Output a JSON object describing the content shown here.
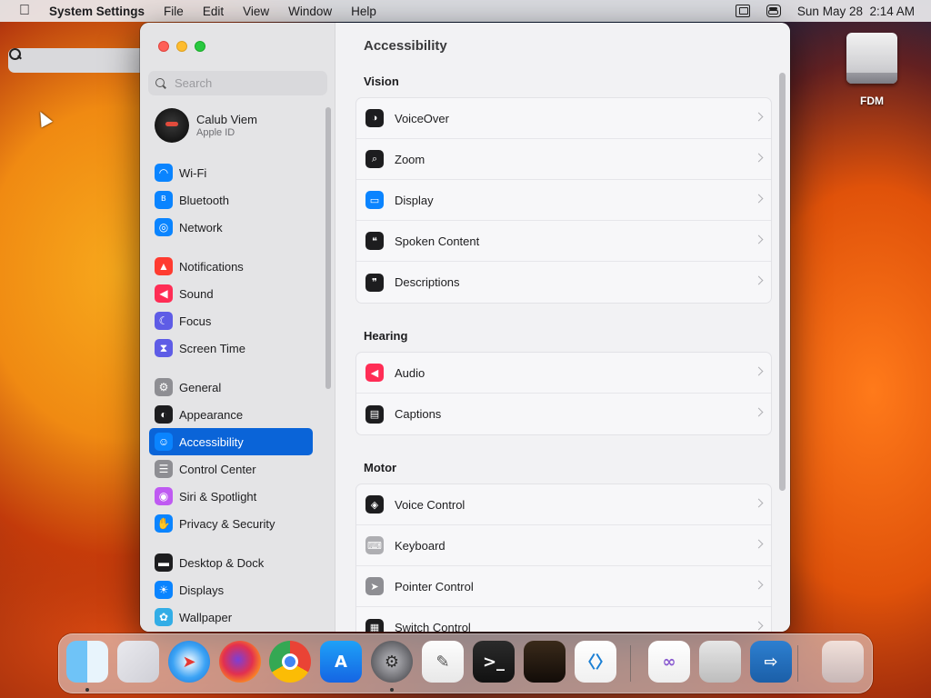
{
  "menubar": {
    "app_name": "System Settings",
    "menus": [
      "File",
      "Edit",
      "View",
      "Window",
      "Help"
    ],
    "clock": "Sun May 28  2:14 AM",
    "status_icons": [
      "window-switcher-icon",
      "spotlight-search-icon",
      "control-center-icon"
    ]
  },
  "desktop": {
    "drive_label": "FDM"
  },
  "sidebar": {
    "search_placeholder": "Search",
    "account_name": "Calub Viem",
    "account_subtitle": "Apple ID",
    "items": [
      {
        "label": "Wi-Fi",
        "icon": "wifi-icon",
        "color": "#0a84ff"
      },
      {
        "label": "Bluetooth",
        "icon": "bluetooth-icon",
        "color": "#0a84ff"
      },
      {
        "label": "Network",
        "icon": "globe-icon",
        "color": "#0a84ff"
      },
      {
        "label": "Notifications",
        "icon": "bell-icon",
        "color": "#ff3b30"
      },
      {
        "label": "Sound",
        "icon": "speaker-icon",
        "color": "#ff2d55"
      },
      {
        "label": "Focus",
        "icon": "moon-icon",
        "color": "#5e5ce6"
      },
      {
        "label": "Screen Time",
        "icon": "hourglass-icon",
        "color": "#5e5ce6"
      },
      {
        "label": "General",
        "icon": "gear-icon",
        "color": "#8e8e93"
      },
      {
        "label": "Appearance",
        "icon": "appearance-icon",
        "color": "#1d1d1f"
      },
      {
        "label": "Accessibility",
        "icon": "accessibility-icon",
        "color": "#0a84ff"
      },
      {
        "label": "Control Center",
        "icon": "control-center-icon",
        "color": "#8e8e93"
      },
      {
        "label": "Siri & Spotlight",
        "icon": "siri-icon",
        "color": "#bf5af2"
      },
      {
        "label": "Privacy & Security",
        "icon": "hand-icon",
        "color": "#0a84ff"
      },
      {
        "label": "Desktop & Dock",
        "icon": "dock-icon",
        "color": "#1d1d1f"
      },
      {
        "label": "Displays",
        "icon": "sun-icon",
        "color": "#0a84ff"
      },
      {
        "label": "Wallpaper",
        "icon": "flower-icon",
        "color": "#32ade6"
      }
    ],
    "selected": "Accessibility"
  },
  "content": {
    "title": "Accessibility",
    "sections": [
      {
        "title": "Vision",
        "rows": [
          {
            "label": "VoiceOver",
            "icon": "voiceover-icon",
            "color": "#1d1d1f"
          },
          {
            "label": "Zoom",
            "icon": "zoom-icon",
            "color": "#1d1d1f"
          },
          {
            "label": "Display",
            "icon": "display-icon",
            "color": "#0a84ff"
          },
          {
            "label": "Spoken Content",
            "icon": "speech-bubble-icon",
            "color": "#1d1d1f"
          },
          {
            "label": "Descriptions",
            "icon": "descriptions-icon",
            "color": "#1d1d1f"
          }
        ]
      },
      {
        "title": "Hearing",
        "rows": [
          {
            "label": "Audio",
            "icon": "speaker-icon",
            "color": "#ff2d55"
          },
          {
            "label": "Captions",
            "icon": "captions-icon",
            "color": "#1d1d1f"
          }
        ]
      },
      {
        "title": "Motor",
        "rows": [
          {
            "label": "Voice Control",
            "icon": "voice-control-icon",
            "color": "#1d1d1f"
          },
          {
            "label": "Keyboard",
            "icon": "keyboard-icon",
            "color": "#aeaeb2"
          },
          {
            "label": "Pointer Control",
            "icon": "pointer-icon",
            "color": "#8e8e93"
          },
          {
            "label": "Switch Control",
            "icon": "switch-control-icon",
            "color": "#1d1d1f"
          }
        ]
      }
    ]
  },
  "dock": {
    "apps": [
      {
        "name": "Finder",
        "icon": "finder-icon",
        "running": true
      },
      {
        "name": "Launchpad",
        "icon": "launchpad-icon",
        "running": false
      },
      {
        "name": "Safari",
        "icon": "safari-icon",
        "running": false
      },
      {
        "name": "Firefox",
        "icon": "firefox-icon",
        "running": false
      },
      {
        "name": "Chrome",
        "icon": "chrome-icon",
        "running": false
      },
      {
        "name": "App Store",
        "icon": "app-store-icon",
        "running": false
      },
      {
        "name": "System Settings",
        "icon": "system-settings-icon",
        "running": true
      },
      {
        "name": "TextEdit",
        "icon": "textedit-icon",
        "running": false
      },
      {
        "name": "Terminal",
        "icon": "terminal-icon",
        "running": false
      },
      {
        "name": "GarageBand",
        "icon": "garageband-icon",
        "running": false
      },
      {
        "name": "Visual Studio Code",
        "icon": "vscode-icon",
        "running": false
      },
      {
        "name": "Visual Studio",
        "icon": "visual-studio-icon",
        "running": false
      },
      {
        "name": "Installer",
        "icon": "installer-icon",
        "running": false
      },
      {
        "name": "Free Download Manager",
        "icon": "fdm-icon",
        "running": false
      },
      {
        "name": "Trash",
        "icon": "trash-icon",
        "running": false
      }
    ]
  }
}
